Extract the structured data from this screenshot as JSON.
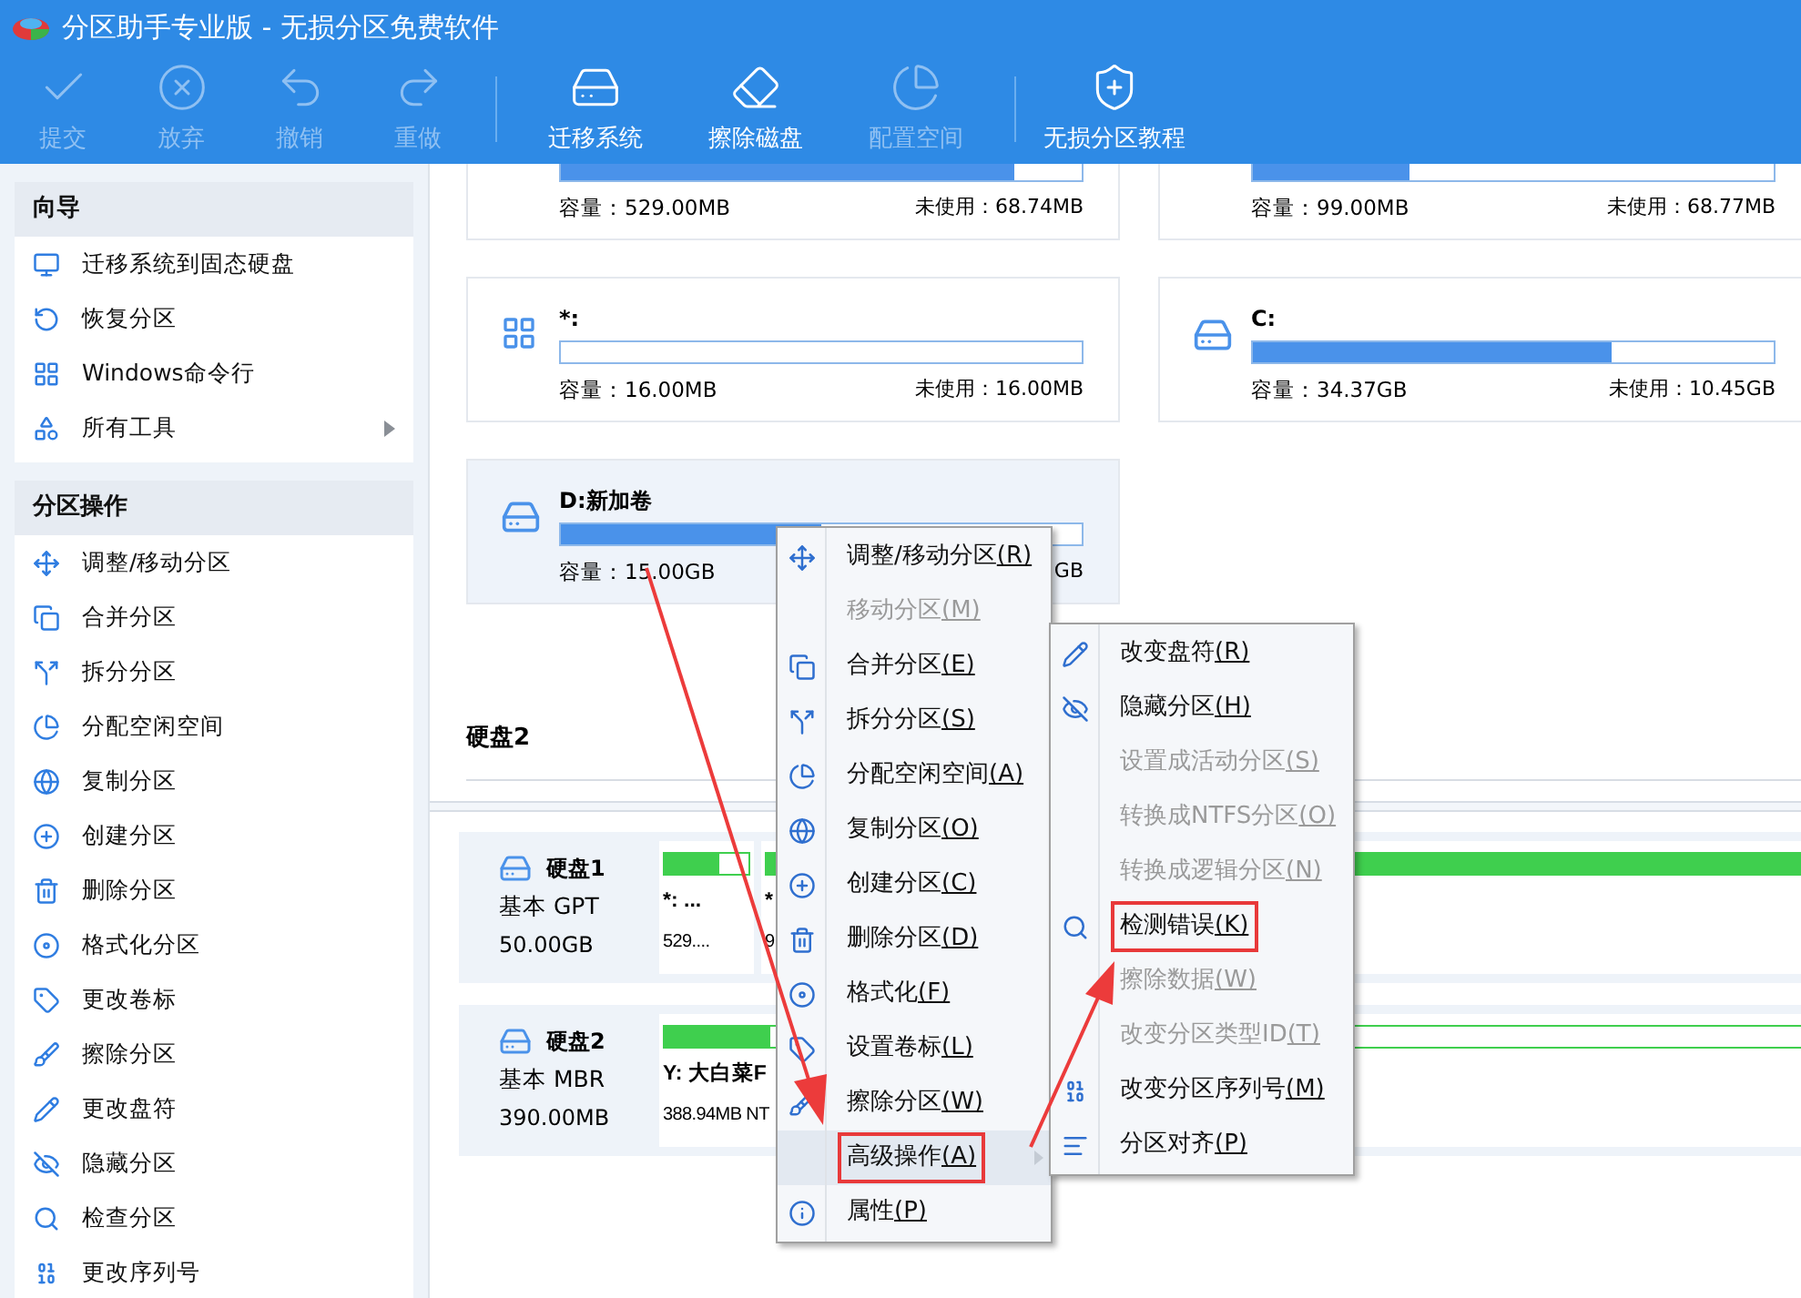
{
  "window": {
    "title": "分区助手专业版 - 无损分区免费软件"
  },
  "toolbar": [
    {
      "label": "提交",
      "enabled": false
    },
    {
      "label": "放弃",
      "enabled": false
    },
    {
      "label": "撤销",
      "enabled": false
    },
    {
      "label": "重做",
      "enabled": false
    },
    {
      "label": "迁移系统",
      "enabled": true
    },
    {
      "label": "擦除磁盘",
      "enabled": true
    },
    {
      "label": "配置空间",
      "enabled": false
    },
    {
      "label": "无损分区教程",
      "enabled": true
    }
  ],
  "sidebar": [
    {
      "title": "向导",
      "items": [
        {
          "label": "迁移系统到固态硬盘",
          "has_submenu": false
        },
        {
          "label": "恢复分区",
          "has_submenu": false
        },
        {
          "label": "Windows命令行",
          "has_submenu": false
        },
        {
          "label": "所有工具",
          "has_submenu": true
        }
      ]
    },
    {
      "title": "分区操作",
      "items": [
        {
          "label": "调整/移动分区",
          "has_submenu": false
        },
        {
          "label": "合并分区",
          "has_submenu": false
        },
        {
          "label": "拆分分区",
          "has_submenu": false
        },
        {
          "label": "分配空闲空间",
          "has_submenu": false
        },
        {
          "label": "复制分区",
          "has_submenu": false
        },
        {
          "label": "创建分区",
          "has_submenu": false
        },
        {
          "label": "删除分区",
          "has_submenu": false
        },
        {
          "label": "格式化分区",
          "has_submenu": false
        },
        {
          "label": "更改卷标",
          "has_submenu": false
        },
        {
          "label": "擦除分区",
          "has_submenu": false
        },
        {
          "label": "更改盘符",
          "has_submenu": false
        },
        {
          "label": "隐藏分区",
          "has_submenu": false
        },
        {
          "label": "检查分区",
          "has_submenu": false
        },
        {
          "label": "更改序列号",
          "has_submenu": false
        }
      ]
    }
  ],
  "partition_cards": [
    {
      "capacity": "容量：529.00MB",
      "free": "未使用：68.74MB",
      "level": 0.87,
      "selected": false
    },
    {
      "capacity": "容量：99.00MB",
      "free": "未使用：68.77MB",
      "level": 0.3,
      "selected": false
    },
    {
      "name": "*:",
      "capacity": "容量：16.00MB",
      "free": "未使用：16.00MB",
      "level": 0,
      "selected": false
    },
    {
      "name": "C:",
      "capacity": "容量：34.37GB",
      "free": "未使用：10.45GB",
      "level": 0.69,
      "selected": false
    },
    {
      "name": "D:新加卷",
      "capacity": "容量：15.00GB",
      "free": "GB",
      "level": 0.5,
      "selected": true
    }
  ],
  "section_label": "硬盘2",
  "disks": [
    {
      "name": "硬盘1",
      "type": "基本 GPT",
      "size": "50.00GB",
      "partitions": [
        {
          "name": "*: ...",
          "size": "529....",
          "level": 0.65
        },
        {
          "name": "*",
          "size": "9",
          "level": 0.97
        }
      ]
    },
    {
      "name": "硬盘2",
      "type": "基本 MBR",
      "size": "390.00MB",
      "partitions": [
        {
          "name": "Y: 大白菜F",
          "size": "388.94MB NT",
          "level": 0.09
        }
      ]
    }
  ],
  "context_menu": [
    {
      "label": "调整/移动分区",
      "shortcut": "(R)",
      "disabled": false,
      "selected": false,
      "has_submenu": false,
      "annotated": false
    },
    {
      "label": "移动分区",
      "shortcut": "(M)",
      "disabled": true,
      "selected": false,
      "has_submenu": false,
      "annotated": false
    },
    {
      "label": "合并分区",
      "shortcut": "(E)",
      "disabled": false,
      "selected": false,
      "has_submenu": false,
      "annotated": false
    },
    {
      "label": "拆分分区",
      "shortcut": "(S)",
      "disabled": false,
      "selected": false,
      "has_submenu": false,
      "annotated": false
    },
    {
      "label": "分配空闲空间",
      "shortcut": "(A)",
      "disabled": false,
      "selected": false,
      "has_submenu": false,
      "annotated": false
    },
    {
      "label": "复制分区",
      "shortcut": "(O)",
      "disabled": false,
      "selected": false,
      "has_submenu": false,
      "annotated": false
    },
    {
      "label": "创建分区",
      "shortcut": "(C)",
      "disabled": false,
      "selected": false,
      "has_submenu": false,
      "annotated": false
    },
    {
      "label": "删除分区",
      "shortcut": "(D)",
      "disabled": false,
      "selected": false,
      "has_submenu": false,
      "annotated": false
    },
    {
      "label": "格式化",
      "shortcut": "(F)",
      "disabled": false,
      "selected": false,
      "has_submenu": false,
      "annotated": false
    },
    {
      "label": "设置卷标",
      "shortcut": "(L)",
      "disabled": false,
      "selected": false,
      "has_submenu": false,
      "annotated": false
    },
    {
      "label": "擦除分区",
      "shortcut": "(W)",
      "disabled": false,
      "selected": false,
      "has_submenu": false,
      "annotated": false
    },
    {
      "label": "高级操作",
      "shortcut": "(A)",
      "disabled": false,
      "selected": true,
      "has_submenu": true,
      "annotated": true
    },
    {
      "label": "属性",
      "shortcut": "(P)",
      "disabled": false,
      "selected": false,
      "has_submenu": false,
      "annotated": false
    }
  ],
  "submenu": [
    {
      "label": "改变盘符",
      "shortcut": "(R)",
      "disabled": false,
      "annotated": false
    },
    {
      "label": "隐藏分区",
      "shortcut": "(H)",
      "disabled": false,
      "annotated": false
    },
    {
      "label": "设置成活动分区",
      "shortcut": "(S)",
      "disabled": true,
      "annotated": false
    },
    {
      "label": "转换成NTFS分区",
      "shortcut": "(O)",
      "disabled": true,
      "annotated": false
    },
    {
      "label": "转换成逻辑分区",
      "shortcut": "(N)",
      "disabled": true,
      "annotated": false
    },
    {
      "label": "检测错误",
      "shortcut": "(K)",
      "disabled": false,
      "annotated": true
    },
    {
      "label": "擦除数据",
      "shortcut": "(W)",
      "disabled": true,
      "annotated": false
    },
    {
      "label": "改变分区类型ID",
      "shortcut": "(T)",
      "disabled": true,
      "annotated": false
    },
    {
      "label": "改变分区序列号",
      "shortcut": "(M)",
      "disabled": false,
      "annotated": false
    },
    {
      "label": "分区对齐",
      "shortcut": "(P)",
      "disabled": false,
      "annotated": false
    }
  ]
}
